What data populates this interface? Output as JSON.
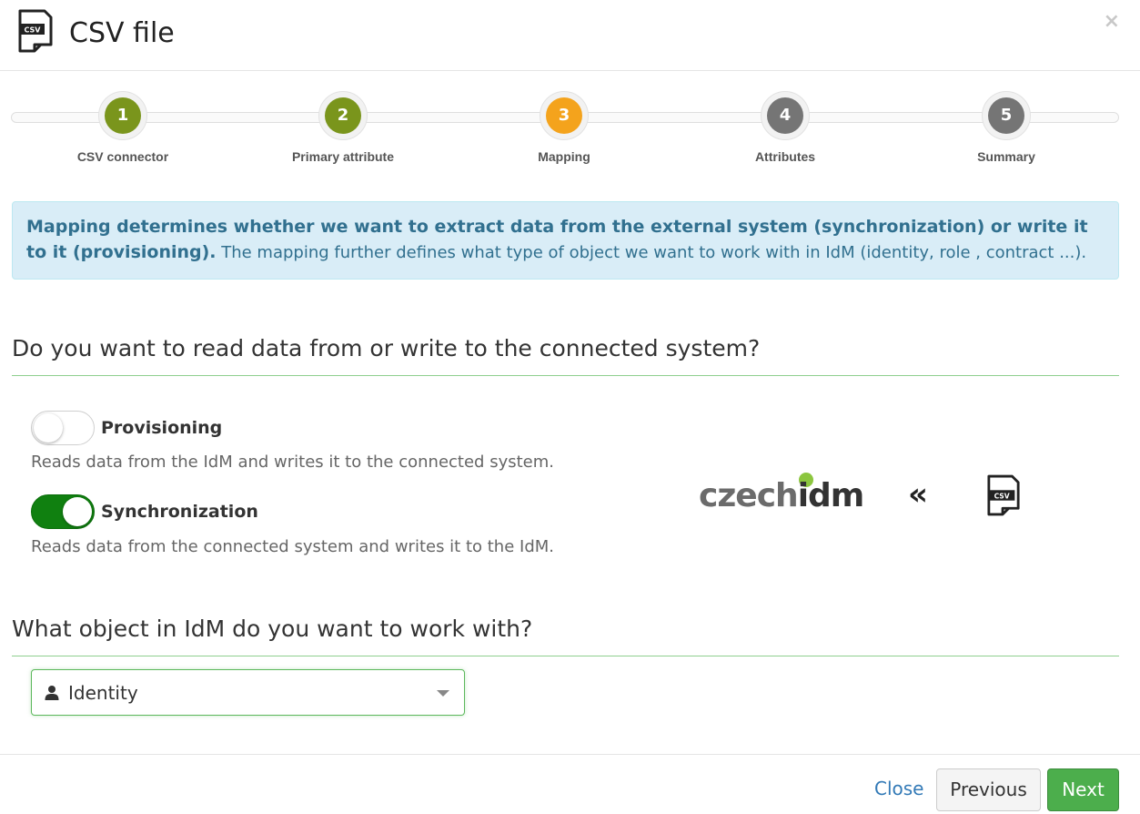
{
  "header": {
    "title": "CSV file",
    "icon_text": "CSV",
    "close_symbol": "×"
  },
  "stepper": {
    "steps": [
      {
        "number": "1",
        "label": "CSV connector",
        "state": "done",
        "color": "#7a951c"
      },
      {
        "number": "2",
        "label": "Primary attribute",
        "state": "done",
        "color": "#7a951c"
      },
      {
        "number": "3",
        "label": "Mapping",
        "state": "active",
        "color": "#f4a31c"
      },
      {
        "number": "4",
        "label": "Attributes",
        "state": "pending",
        "color": "#757575"
      },
      {
        "number": "5",
        "label": "Summary",
        "state": "pending",
        "color": "#757575"
      }
    ]
  },
  "alert": {
    "bold_text": "Mapping determines whether we want to extract data from the external system (synchronization) or write it to it (provisioning).",
    "rest_text": " The mapping further defines what type of object we want to work with in IdM (identity, role , contract ...)."
  },
  "direction_section": {
    "title": "Do you want to read data from or write to the connected system?",
    "provisioning": {
      "label": "Provisioning",
      "help": "Reads data from the IdM and writes it to the connected system.",
      "enabled": false
    },
    "synchronization": {
      "label": "Synchronization",
      "help": "Reads data from the connected system and writes it to the IdM.",
      "enabled": true
    },
    "logo": {
      "brand_left": "czech",
      "brand_right": "idm",
      "arrow": "«",
      "csv_icon_text": "CSV"
    }
  },
  "object_section": {
    "title": "What object in IdM do you want to work with?",
    "select_value": "Identity",
    "select_icon": "user-icon"
  },
  "footer": {
    "close_label": "Close",
    "previous_label": "Previous",
    "next_label": "Next"
  },
  "colors": {
    "accent_green": "#4cae4c",
    "toggle_on": "#108010",
    "alert_bg": "#d9edf7",
    "alert_text": "#31708f",
    "link": "#337ab7"
  }
}
